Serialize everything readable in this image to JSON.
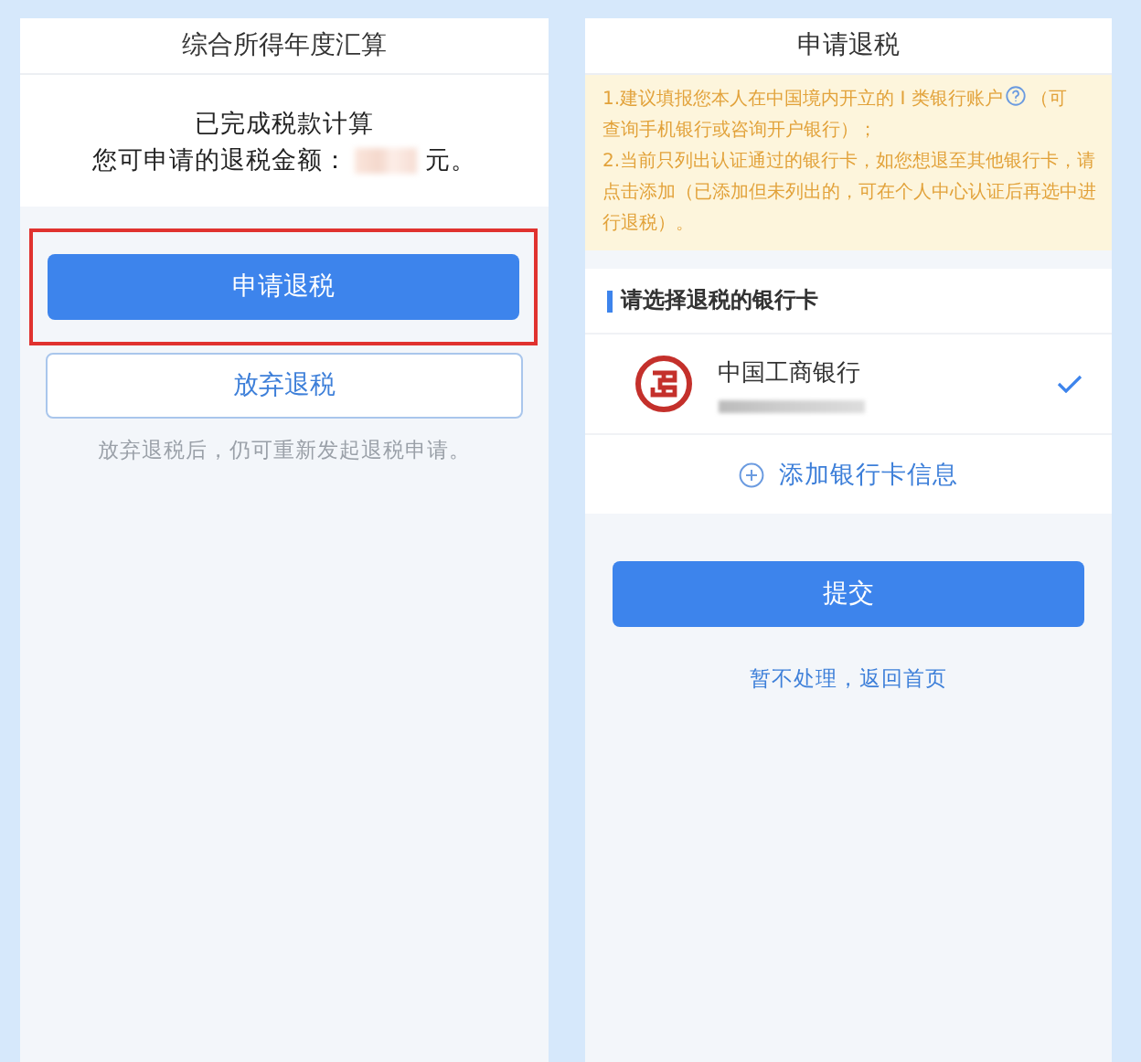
{
  "left_screen": {
    "title": "综合所得年度汇算",
    "status": "已完成税款计算",
    "amount_label": "您可申请的退税金额：",
    "amount_suffix": "元。",
    "primary_button": "申请退税",
    "primary_highlighted": true,
    "secondary_button": "放弃退税",
    "hint": "放弃退税后，仍可重新发起退税申请。"
  },
  "right_screen": {
    "title": "申请退税",
    "notice_1_before": "1.建议填报您本人在中国境内开立的 I 类银行账户",
    "notice_1_after": "（可",
    "notice_1_continued": "查询手机银行或咨询开户银行）；",
    "notice_2": "2.当前只列出认证通过的银行卡，如您想退至其他银行卡，请点击添加（已添加但未列出的，可在个人中心认证后再选中进行退税）。",
    "section_title": "请选择退税的银行卡",
    "banks": [
      {
        "name": "中国工商银行",
        "selected": true
      }
    ],
    "add_card": "添加银行卡信息",
    "submit_button": "提交",
    "back_link": "暂不处理，返回首页"
  }
}
